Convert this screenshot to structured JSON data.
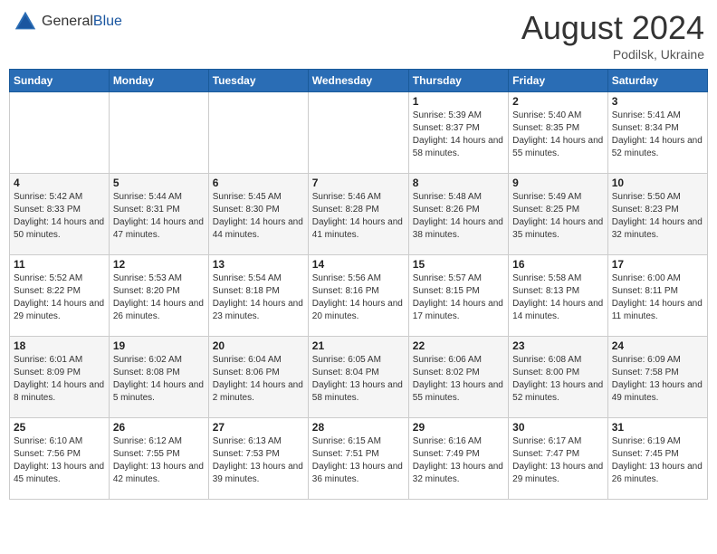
{
  "header": {
    "logo": {
      "general": "General",
      "blue": "Blue"
    },
    "title": "August 2024",
    "subtitle": "Podilsk, Ukraine"
  },
  "days_of_week": [
    "Sunday",
    "Monday",
    "Tuesday",
    "Wednesday",
    "Thursday",
    "Friday",
    "Saturday"
  ],
  "weeks": [
    [
      {
        "num": "",
        "sunrise": "",
        "sunset": "",
        "daylight": ""
      },
      {
        "num": "",
        "sunrise": "",
        "sunset": "",
        "daylight": ""
      },
      {
        "num": "",
        "sunrise": "",
        "sunset": "",
        "daylight": ""
      },
      {
        "num": "",
        "sunrise": "",
        "sunset": "",
        "daylight": ""
      },
      {
        "num": "1",
        "sunrise": "Sunrise: 5:39 AM",
        "sunset": "Sunset: 8:37 PM",
        "daylight": "Daylight: 14 hours and 58 minutes."
      },
      {
        "num": "2",
        "sunrise": "Sunrise: 5:40 AM",
        "sunset": "Sunset: 8:35 PM",
        "daylight": "Daylight: 14 hours and 55 minutes."
      },
      {
        "num": "3",
        "sunrise": "Sunrise: 5:41 AM",
        "sunset": "Sunset: 8:34 PM",
        "daylight": "Daylight: 14 hours and 52 minutes."
      }
    ],
    [
      {
        "num": "4",
        "sunrise": "Sunrise: 5:42 AM",
        "sunset": "Sunset: 8:33 PM",
        "daylight": "Daylight: 14 hours and 50 minutes."
      },
      {
        "num": "5",
        "sunrise": "Sunrise: 5:44 AM",
        "sunset": "Sunset: 8:31 PM",
        "daylight": "Daylight: 14 hours and 47 minutes."
      },
      {
        "num": "6",
        "sunrise": "Sunrise: 5:45 AM",
        "sunset": "Sunset: 8:30 PM",
        "daylight": "Daylight: 14 hours and 44 minutes."
      },
      {
        "num": "7",
        "sunrise": "Sunrise: 5:46 AM",
        "sunset": "Sunset: 8:28 PM",
        "daylight": "Daylight: 14 hours and 41 minutes."
      },
      {
        "num": "8",
        "sunrise": "Sunrise: 5:48 AM",
        "sunset": "Sunset: 8:26 PM",
        "daylight": "Daylight: 14 hours and 38 minutes."
      },
      {
        "num": "9",
        "sunrise": "Sunrise: 5:49 AM",
        "sunset": "Sunset: 8:25 PM",
        "daylight": "Daylight: 14 hours and 35 minutes."
      },
      {
        "num": "10",
        "sunrise": "Sunrise: 5:50 AM",
        "sunset": "Sunset: 8:23 PM",
        "daylight": "Daylight: 14 hours and 32 minutes."
      }
    ],
    [
      {
        "num": "11",
        "sunrise": "Sunrise: 5:52 AM",
        "sunset": "Sunset: 8:22 PM",
        "daylight": "Daylight: 14 hours and 29 minutes."
      },
      {
        "num": "12",
        "sunrise": "Sunrise: 5:53 AM",
        "sunset": "Sunset: 8:20 PM",
        "daylight": "Daylight: 14 hours and 26 minutes."
      },
      {
        "num": "13",
        "sunrise": "Sunrise: 5:54 AM",
        "sunset": "Sunset: 8:18 PM",
        "daylight": "Daylight: 14 hours and 23 minutes."
      },
      {
        "num": "14",
        "sunrise": "Sunrise: 5:56 AM",
        "sunset": "Sunset: 8:16 PM",
        "daylight": "Daylight: 14 hours and 20 minutes."
      },
      {
        "num": "15",
        "sunrise": "Sunrise: 5:57 AM",
        "sunset": "Sunset: 8:15 PM",
        "daylight": "Daylight: 14 hours and 17 minutes."
      },
      {
        "num": "16",
        "sunrise": "Sunrise: 5:58 AM",
        "sunset": "Sunset: 8:13 PM",
        "daylight": "Daylight: 14 hours and 14 minutes."
      },
      {
        "num": "17",
        "sunrise": "Sunrise: 6:00 AM",
        "sunset": "Sunset: 8:11 PM",
        "daylight": "Daylight: 14 hours and 11 minutes."
      }
    ],
    [
      {
        "num": "18",
        "sunrise": "Sunrise: 6:01 AM",
        "sunset": "Sunset: 8:09 PM",
        "daylight": "Daylight: 14 hours and 8 minutes."
      },
      {
        "num": "19",
        "sunrise": "Sunrise: 6:02 AM",
        "sunset": "Sunset: 8:08 PM",
        "daylight": "Daylight: 14 hours and 5 minutes."
      },
      {
        "num": "20",
        "sunrise": "Sunrise: 6:04 AM",
        "sunset": "Sunset: 8:06 PM",
        "daylight": "Daylight: 14 hours and 2 minutes."
      },
      {
        "num": "21",
        "sunrise": "Sunrise: 6:05 AM",
        "sunset": "Sunset: 8:04 PM",
        "daylight": "Daylight: 13 hours and 58 minutes."
      },
      {
        "num": "22",
        "sunrise": "Sunrise: 6:06 AM",
        "sunset": "Sunset: 8:02 PM",
        "daylight": "Daylight: 13 hours and 55 minutes."
      },
      {
        "num": "23",
        "sunrise": "Sunrise: 6:08 AM",
        "sunset": "Sunset: 8:00 PM",
        "daylight": "Daylight: 13 hours and 52 minutes."
      },
      {
        "num": "24",
        "sunrise": "Sunrise: 6:09 AM",
        "sunset": "Sunset: 7:58 PM",
        "daylight": "Daylight: 13 hours and 49 minutes."
      }
    ],
    [
      {
        "num": "25",
        "sunrise": "Sunrise: 6:10 AM",
        "sunset": "Sunset: 7:56 PM",
        "daylight": "Daylight: 13 hours and 45 minutes."
      },
      {
        "num": "26",
        "sunrise": "Sunrise: 6:12 AM",
        "sunset": "Sunset: 7:55 PM",
        "daylight": "Daylight: 13 hours and 42 minutes."
      },
      {
        "num": "27",
        "sunrise": "Sunrise: 6:13 AM",
        "sunset": "Sunset: 7:53 PM",
        "daylight": "Daylight: 13 hours and 39 minutes."
      },
      {
        "num": "28",
        "sunrise": "Sunrise: 6:15 AM",
        "sunset": "Sunset: 7:51 PM",
        "daylight": "Daylight: 13 hours and 36 minutes."
      },
      {
        "num": "29",
        "sunrise": "Sunrise: 6:16 AM",
        "sunset": "Sunset: 7:49 PM",
        "daylight": "Daylight: 13 hours and 32 minutes."
      },
      {
        "num": "30",
        "sunrise": "Sunrise: 6:17 AM",
        "sunset": "Sunset: 7:47 PM",
        "daylight": "Daylight: 13 hours and 29 minutes."
      },
      {
        "num": "31",
        "sunrise": "Sunrise: 6:19 AM",
        "sunset": "Sunset: 7:45 PM",
        "daylight": "Daylight: 13 hours and 26 minutes."
      }
    ]
  ]
}
